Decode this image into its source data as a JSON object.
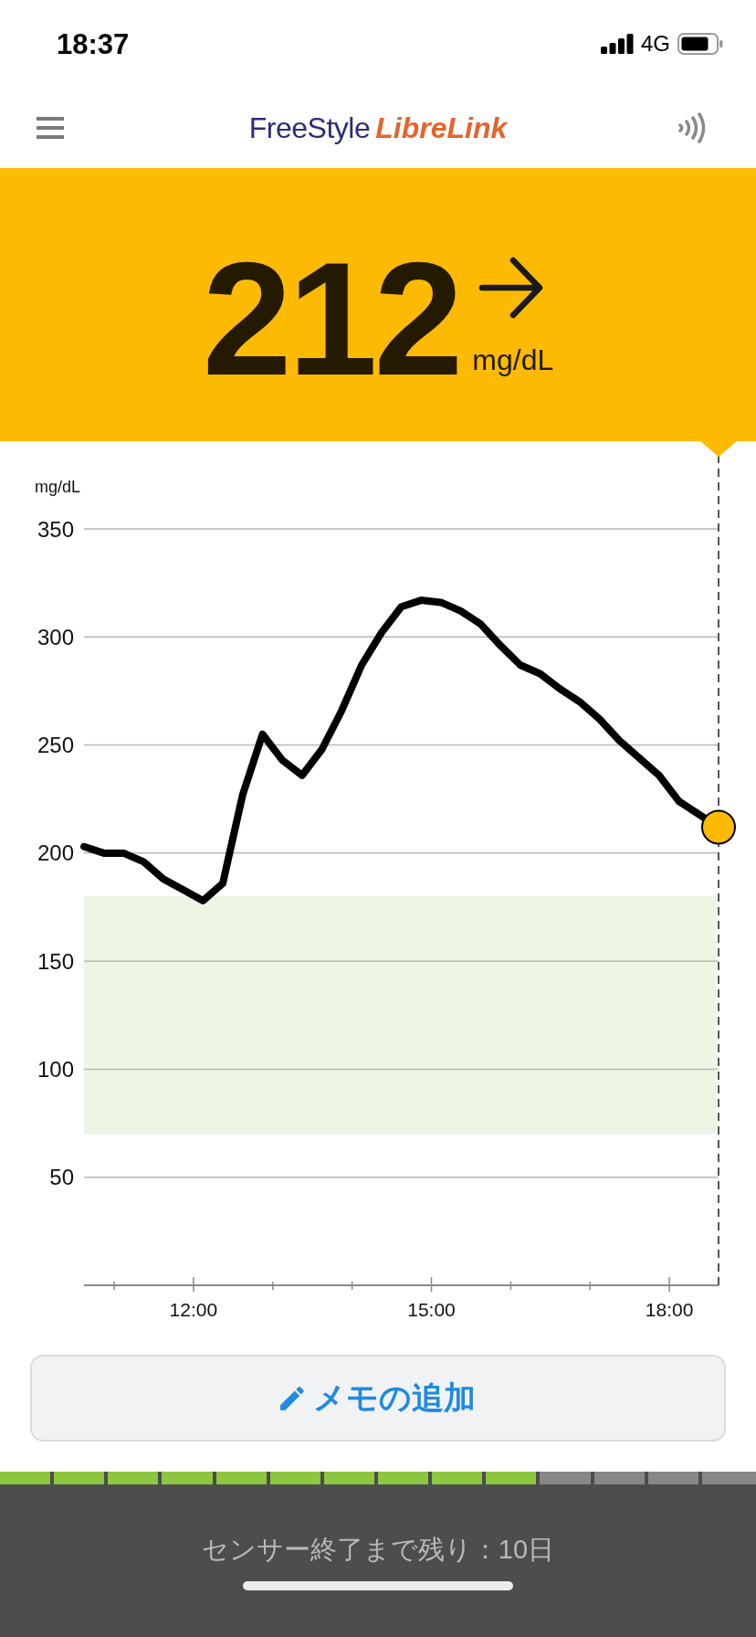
{
  "status_bar": {
    "time": "18:37",
    "network": "4G"
  },
  "header": {
    "logo": {
      "first_word": "FreeStyle",
      "second_word": "LibreLink"
    }
  },
  "reading": {
    "value": "212",
    "unit": "mg/dL"
  },
  "chart": {
    "chart_data": {
      "type": "line",
      "ylabel": "mg/dL",
      "x": [
        10.62,
        10.87,
        11.12,
        11.37,
        11.62,
        11.87,
        12.12,
        12.37,
        12.62,
        12.87,
        13.12,
        13.37,
        13.62,
        13.87,
        14.12,
        14.37,
        14.62,
        14.87,
        15.12,
        15.37,
        15.62,
        15.87,
        16.12,
        16.37,
        16.62,
        16.87,
        17.12,
        17.37,
        17.62,
        17.87,
        18.12,
        18.37,
        18.62
      ],
      "values": [
        203,
        200,
        200,
        196,
        188,
        183,
        178,
        186,
        227,
        255,
        243,
        236,
        248,
        266,
        287,
        302,
        314,
        317,
        316,
        312,
        306,
        296,
        287,
        283,
        276,
        270,
        262,
        252,
        244,
        236,
        224,
        218,
        212
      ],
      "xlim": [
        10.62,
        18.62
      ],
      "ylim": [
        0,
        350
      ],
      "xticks": [
        {
          "value": 12,
          "label": "12:00"
        },
        {
          "value": 15,
          "label": "15:00"
        },
        {
          "value": 18,
          "label": "18:00"
        }
      ],
      "yticks": [
        50,
        100,
        150,
        200,
        250,
        300,
        350
      ],
      "grid": true,
      "bands": [
        {
          "axis": "y",
          "from": 70,
          "to": 180
        }
      ]
    }
  },
  "memo_button": {
    "label": "メモの追加"
  },
  "sensor": {
    "level": 0.714,
    "remaining": "センサー終了まで残り：10日"
  }
}
